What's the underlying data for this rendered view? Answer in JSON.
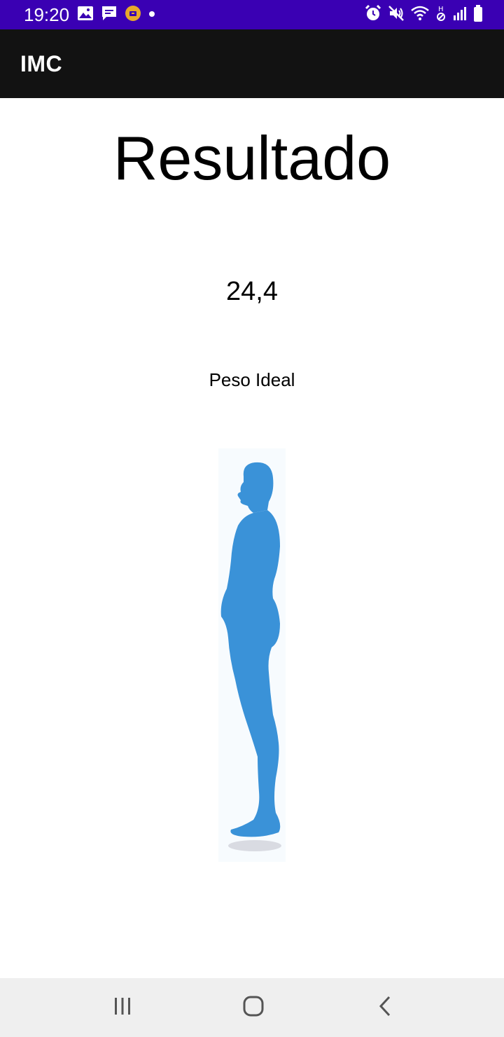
{
  "status_bar": {
    "time": "19:20",
    "background": "#3a00b3",
    "left_icons": [
      "image-icon",
      "message-icon",
      "app-notification-icon",
      "dot-icon"
    ],
    "right_icons": [
      "alarm-icon",
      "mute-icon",
      "wifi-icon",
      "data-icon",
      "signal-icon",
      "battery-icon"
    ]
  },
  "app_bar": {
    "title": "IMC",
    "background": "#121212"
  },
  "result": {
    "heading": "Resultado",
    "value": "24,4",
    "classification": "Peso Ideal",
    "figure_icon": "body-silhouette-icon",
    "figure_color": "#3a92d8"
  },
  "nav_bar": {
    "buttons": [
      "recent-apps-icon",
      "home-icon",
      "back-icon"
    ]
  }
}
